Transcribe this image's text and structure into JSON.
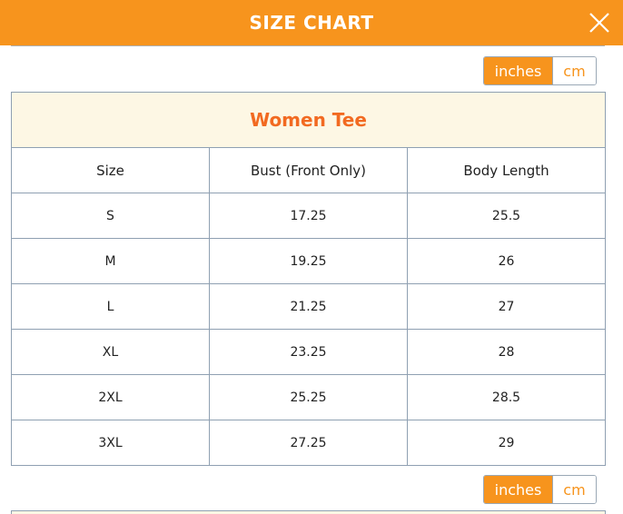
{
  "header": {
    "title": "SIZE CHART",
    "close_icon": "close-icon"
  },
  "unit_toggle": {
    "active": "inches",
    "inactive": "cm"
  },
  "table": {
    "title": "Women Tee",
    "columns": [
      "Size",
      "Bust (Front Only)",
      "Body Length"
    ],
    "rows": [
      [
        "S",
        "17.25",
        "25.5"
      ],
      [
        "M",
        "19.25",
        "26"
      ],
      [
        "L",
        "21.25",
        "27"
      ],
      [
        "XL",
        "23.25",
        "28"
      ],
      [
        "2XL",
        "25.25",
        "28.5"
      ],
      [
        "3XL",
        "27.25",
        "29"
      ]
    ]
  },
  "colors": {
    "accent": "#f7941d",
    "title_text": "#f26a21",
    "title_bg": "#fdf7e4",
    "border": "#8fa0b2"
  }
}
